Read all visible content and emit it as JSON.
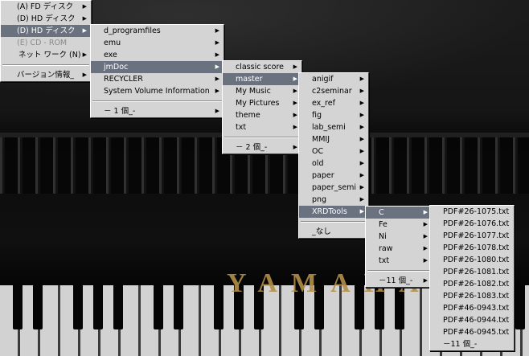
{
  "piano": {
    "brand": "YAMAHA"
  },
  "colors": {
    "menu_bg": "#d4d4d4",
    "highlight": "#6a7280"
  },
  "menus": {
    "m1": {
      "items": [
        {
          "label": "(A) FD ディスク",
          "submenu": true,
          "state": "normal"
        },
        {
          "label": "(D) HD ディスク",
          "submenu": true,
          "state": "normal"
        },
        {
          "label": "(D) HD ディスク",
          "submenu": true,
          "state": "selected"
        },
        {
          "label": "(E) CD - ROM",
          "submenu": false,
          "state": "disabled"
        },
        {
          "label": "ネット ワーク (N)",
          "submenu": true,
          "state": "normal"
        }
      ],
      "footer": {
        "label": "バージョン情報_",
        "submenu": true
      }
    },
    "m2": {
      "items": [
        {
          "label": "d_programfiles",
          "submenu": true,
          "state": "normal"
        },
        {
          "label": "emu",
          "submenu": true,
          "state": "normal"
        },
        {
          "label": "exe",
          "submenu": true,
          "state": "normal"
        },
        {
          "label": "jmDoc",
          "submenu": true,
          "state": "selected"
        },
        {
          "label": "RECYCLER",
          "submenu": true,
          "state": "normal"
        },
        {
          "label": "System Volume Information",
          "submenu": true,
          "state": "normal"
        }
      ],
      "footer": {
        "label": "－ 1 個_-",
        "submenu": true
      }
    },
    "m3": {
      "items": [
        {
          "label": "classic score",
          "submenu": true,
          "state": "normal"
        },
        {
          "label": "master",
          "submenu": true,
          "state": "selected"
        },
        {
          "label": "My Music",
          "submenu": true,
          "state": "normal"
        },
        {
          "label": "My Pictures",
          "submenu": true,
          "state": "normal"
        },
        {
          "label": "theme",
          "submenu": true,
          "state": "normal"
        },
        {
          "label": "txt",
          "submenu": true,
          "state": "normal"
        }
      ],
      "footer": {
        "label": "－ 2 個_-",
        "submenu": true
      }
    },
    "m4": {
      "items": [
        {
          "label": "anigif",
          "submenu": true,
          "state": "normal"
        },
        {
          "label": "c2seminar",
          "submenu": true,
          "state": "normal"
        },
        {
          "label": "ex_ref",
          "submenu": true,
          "state": "normal"
        },
        {
          "label": "fig",
          "submenu": true,
          "state": "normal"
        },
        {
          "label": "lab_semi",
          "submenu": true,
          "state": "normal"
        },
        {
          "label": "MMIJ",
          "submenu": true,
          "state": "normal"
        },
        {
          "label": "OC",
          "submenu": true,
          "state": "normal"
        },
        {
          "label": "old",
          "submenu": true,
          "state": "normal"
        },
        {
          "label": "paper",
          "submenu": true,
          "state": "normal"
        },
        {
          "label": "paper_semi",
          "submenu": true,
          "state": "normal"
        },
        {
          "label": "png",
          "submenu": true,
          "state": "normal"
        },
        {
          "label": "XRDTools",
          "submenu": true,
          "state": "selected"
        }
      ],
      "footer": {
        "label": "_なし",
        "submenu": false
      }
    },
    "m5": {
      "items": [
        {
          "label": "C",
          "submenu": true,
          "state": "selected"
        },
        {
          "label": "Fe",
          "submenu": true,
          "state": "normal"
        },
        {
          "label": "Ni",
          "submenu": true,
          "state": "normal"
        },
        {
          "label": "raw",
          "submenu": true,
          "state": "normal"
        },
        {
          "label": "txt",
          "submenu": true,
          "state": "normal"
        }
      ],
      "footer": {
        "label": "－11 個_-",
        "submenu": true
      }
    },
    "m6": {
      "items": [
        {
          "label": "PDF#26-1075.txt",
          "submenu": false,
          "state": "normal"
        },
        {
          "label": "PDF#26-1076.txt",
          "submenu": false,
          "state": "normal"
        },
        {
          "label": "PDF#26-1077.txt",
          "submenu": false,
          "state": "normal"
        },
        {
          "label": "PDF#26-1078.txt",
          "submenu": false,
          "state": "normal"
        },
        {
          "label": "PDF#26-1080.txt",
          "submenu": false,
          "state": "normal"
        },
        {
          "label": "PDF#26-1081.txt",
          "submenu": false,
          "state": "normal"
        },
        {
          "label": "PDF#26-1082.txt",
          "submenu": false,
          "state": "normal"
        },
        {
          "label": "PDF#26-1083.txt",
          "submenu": false,
          "state": "normal"
        },
        {
          "label": "PDF#46-0943.txt",
          "submenu": false,
          "state": "normal"
        },
        {
          "label": "PDF#46-0944.txt",
          "submenu": false,
          "state": "normal"
        },
        {
          "label": "PDF#46-0945.txt",
          "submenu": false,
          "state": "normal"
        }
      ],
      "footer": {
        "label": "－11 個_-",
        "submenu": false
      }
    }
  }
}
